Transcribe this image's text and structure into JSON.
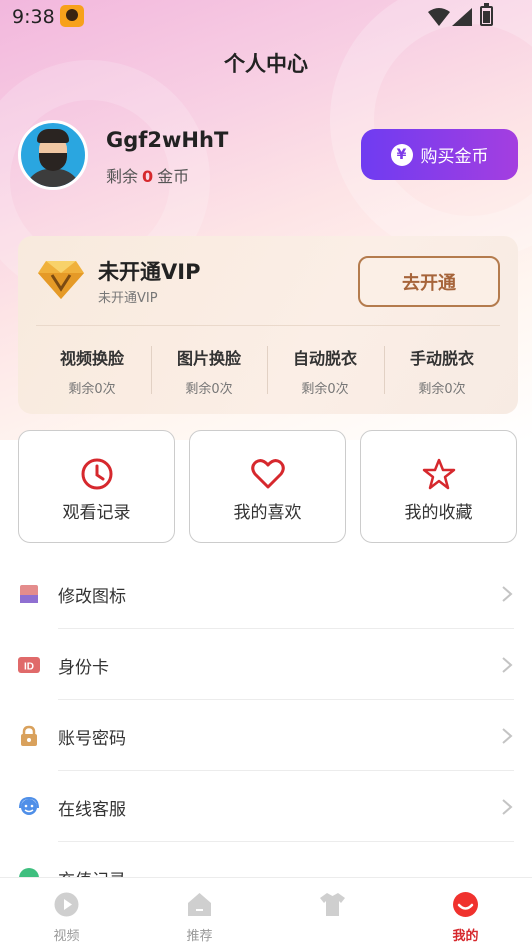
{
  "status_bar": {
    "time": "9:38"
  },
  "header": {
    "title": "个人中心"
  },
  "profile": {
    "username": "Ggf2wHhT",
    "coins_prefix": "剩余",
    "coins_value": "0",
    "coins_suffix": "金币",
    "buy_button_label": "购买金币",
    "buy_icon_glyph": "¥"
  },
  "vip": {
    "title": "未开通VIP",
    "subtitle": "未开通VIP",
    "open_button_label": "去开通",
    "stats": [
      {
        "label": "视频换脸",
        "count": "剩余0次"
      },
      {
        "label": "图片换脸",
        "count": "剩余0次"
      },
      {
        "label": "自动脱衣",
        "count": "剩余0次"
      },
      {
        "label": "手动脱衣",
        "count": "剩余0次"
      }
    ]
  },
  "quick_actions": [
    {
      "label": "观看记录",
      "icon": "clock-icon"
    },
    {
      "label": "我的喜欢",
      "icon": "heart-icon"
    },
    {
      "label": "我的收藏",
      "icon": "star-icon"
    }
  ],
  "menu": [
    {
      "label": "修改图标",
      "icon": "palette-icon"
    },
    {
      "label": "身份卡",
      "icon": "id-card-icon",
      "icon_text": "ID"
    },
    {
      "label": "账号密码",
      "icon": "lock-icon"
    },
    {
      "label": "在线客服",
      "icon": "headset-icon"
    },
    {
      "label": "充值记录",
      "icon": "recharge-icon"
    }
  ],
  "tabbar": [
    {
      "label": "视频",
      "icon": "video-icon"
    },
    {
      "label": "推荐",
      "icon": "home-icon"
    },
    {
      "label": "",
      "icon": "tshirt-icon"
    },
    {
      "label": "我的",
      "icon": "profile-icon",
      "active": true
    }
  ],
  "colors": {
    "accent_red": "#d6282d",
    "buy_gradient_start": "#6f3cf1",
    "buy_gradient_end": "#a43ee0",
    "vip_gold": "#b47b4d"
  }
}
